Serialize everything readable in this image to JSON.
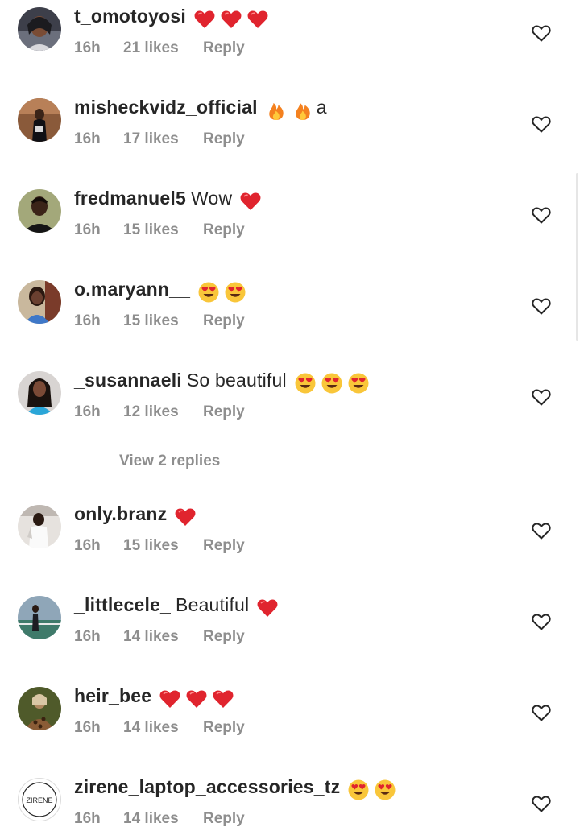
{
  "comments": [
    {
      "username": "t_omotoyosi",
      "text": "",
      "emojis": [
        "red-heart",
        "red-heart",
        "red-heart"
      ],
      "time": "16h",
      "likes": "21 likes",
      "reply": "Reply"
    },
    {
      "username": "misheckvidz_official",
      "text": "",
      "emojis": [
        "fire",
        "fire"
      ],
      "suffix": "a",
      "time": "16h",
      "likes": "17 likes",
      "reply": "Reply"
    },
    {
      "username": "fredmanuel5",
      "text": "Wow",
      "emojis": [
        "red-heart"
      ],
      "time": "16h",
      "likes": "15 likes",
      "reply": "Reply"
    },
    {
      "username": "o.maryann__",
      "text": "",
      "emojis": [
        "heart-eyes",
        "heart-eyes"
      ],
      "time": "16h",
      "likes": "15 likes",
      "reply": "Reply"
    },
    {
      "username": "_susannaeli",
      "text": "So beautiful",
      "emojis": [
        "heart-eyes",
        "heart-eyes",
        "heart-eyes"
      ],
      "time": "16h",
      "likes": "12 likes",
      "reply": "Reply"
    },
    {
      "username": "only.branz",
      "text": "",
      "emojis": [
        "red-heart"
      ],
      "time": "16h",
      "likes": "15 likes",
      "reply": "Reply"
    },
    {
      "username": "_littlecele_",
      "text": "Beautiful",
      "emojis": [
        "red-heart"
      ],
      "time": "16h",
      "likes": "14 likes",
      "reply": "Reply"
    },
    {
      "username": "heir_bee",
      "text": "",
      "emojis": [
        "red-heart",
        "red-heart",
        "red-heart"
      ],
      "time": "16h",
      "likes": "14 likes",
      "reply": "Reply"
    },
    {
      "username": "zirene_laptop_accessories_tz",
      "text": "",
      "emojis": [
        "heart-eyes",
        "heart-eyes"
      ],
      "time": "16h",
      "likes": "14 likes",
      "reply": "Reply",
      "avatar_logo_text": "ZIRENE"
    }
  ],
  "view_replies": "View 2 replies",
  "colors": {
    "username": "#262626",
    "meta": "#8e8e8e",
    "heart_outline": "#262626",
    "red_heart": "#e0242e",
    "emoji_face": "#f9c63a"
  },
  "icons": {
    "like": "heart-outline-icon",
    "red-heart": "red-heart-emoji",
    "fire": "fire-emoji",
    "heart-eyes": "heart-eyes-emoji"
  }
}
